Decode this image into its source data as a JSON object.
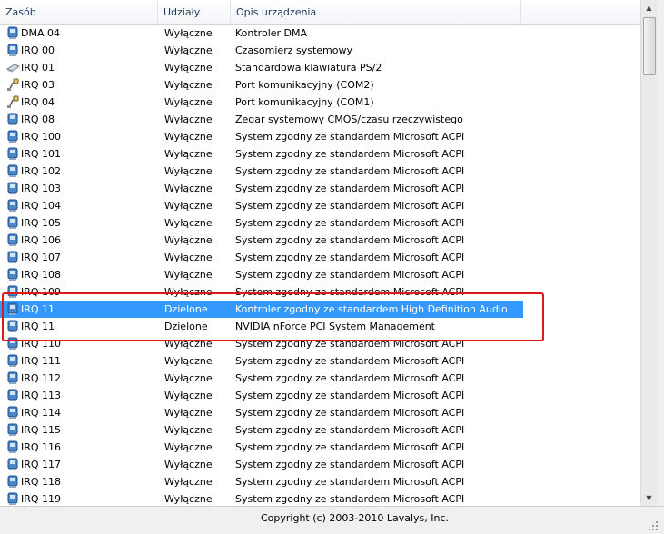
{
  "columns": {
    "resource": "Zasób",
    "shares": "Udziały",
    "description": "Opis urządzenia"
  },
  "rows": [
    {
      "icon": "device-icon",
      "resource": "DMA 04",
      "share": "Wyłączne",
      "description": "Kontroler DMA"
    },
    {
      "icon": "device-icon",
      "resource": "IRQ 00",
      "share": "Wyłączne",
      "description": "Czasomierz systemowy"
    },
    {
      "icon": "keyboard-icon",
      "resource": "IRQ 01",
      "share": "Wyłączne",
      "description": "Standardowa klawiatura PS/2"
    },
    {
      "icon": "port-icon",
      "resource": "IRQ 03",
      "share": "Wyłączne",
      "description": "Port komunikacyjny (COM2)"
    },
    {
      "icon": "port-icon",
      "resource": "IRQ 04",
      "share": "Wyłączne",
      "description": "Port komunikacyjny (COM1)"
    },
    {
      "icon": "device-icon",
      "resource": "IRQ 08",
      "share": "Wyłączne",
      "description": "Zegar systemowy CMOS/czasu rzeczywistego"
    },
    {
      "icon": "device-icon",
      "resource": "IRQ 100",
      "share": "Wyłączne",
      "description": "System zgodny ze standardem Microsoft ACPI"
    },
    {
      "icon": "device-icon",
      "resource": "IRQ 101",
      "share": "Wyłączne",
      "description": "System zgodny ze standardem Microsoft ACPI"
    },
    {
      "icon": "device-icon",
      "resource": "IRQ 102",
      "share": "Wyłączne",
      "description": "System zgodny ze standardem Microsoft ACPI"
    },
    {
      "icon": "device-icon",
      "resource": "IRQ 103",
      "share": "Wyłączne",
      "description": "System zgodny ze standardem Microsoft ACPI"
    },
    {
      "icon": "device-icon",
      "resource": "IRQ 104",
      "share": "Wyłączne",
      "description": "System zgodny ze standardem Microsoft ACPI"
    },
    {
      "icon": "device-icon",
      "resource": "IRQ 105",
      "share": "Wyłączne",
      "description": "System zgodny ze standardem Microsoft ACPI"
    },
    {
      "icon": "device-icon",
      "resource": "IRQ 106",
      "share": "Wyłączne",
      "description": "System zgodny ze standardem Microsoft ACPI"
    },
    {
      "icon": "device-icon",
      "resource": "IRQ 107",
      "share": "Wyłączne",
      "description": "System zgodny ze standardem Microsoft ACPI"
    },
    {
      "icon": "device-icon",
      "resource": "IRQ 108",
      "share": "Wyłączne",
      "description": "System zgodny ze standardem Microsoft ACPI"
    },
    {
      "icon": "device-icon",
      "resource": "IRQ 109",
      "share": "Wyłączne",
      "description": "System zgodny ze standardem Microsoft ACPI"
    },
    {
      "icon": "device-icon",
      "resource": "IRQ 11",
      "share": "Dzielone",
      "description": "Kontroler zgodny ze standardem High Definition Audio",
      "selected": true
    },
    {
      "icon": "device-icon",
      "resource": "IRQ 11",
      "share": "Dzielone",
      "description": "NVIDIA nForce PCI System Management"
    },
    {
      "icon": "device-icon",
      "resource": "IRQ 110",
      "share": "Wyłączne",
      "description": "System zgodny ze standardem Microsoft ACPI"
    },
    {
      "icon": "device-icon",
      "resource": "IRQ 111",
      "share": "Wyłączne",
      "description": "System zgodny ze standardem Microsoft ACPI"
    },
    {
      "icon": "device-icon",
      "resource": "IRQ 112",
      "share": "Wyłączne",
      "description": "System zgodny ze standardem Microsoft ACPI"
    },
    {
      "icon": "device-icon",
      "resource": "IRQ 113",
      "share": "Wyłączne",
      "description": "System zgodny ze standardem Microsoft ACPI"
    },
    {
      "icon": "device-icon",
      "resource": "IRQ 114",
      "share": "Wyłączne",
      "description": "System zgodny ze standardem Microsoft ACPI"
    },
    {
      "icon": "device-icon",
      "resource": "IRQ 115",
      "share": "Wyłączne",
      "description": "System zgodny ze standardem Microsoft ACPI"
    },
    {
      "icon": "device-icon",
      "resource": "IRQ 116",
      "share": "Wyłączne",
      "description": "System zgodny ze standardem Microsoft ACPI"
    },
    {
      "icon": "device-icon",
      "resource": "IRQ 117",
      "share": "Wyłączne",
      "description": "System zgodny ze standardem Microsoft ACPI"
    },
    {
      "icon": "device-icon",
      "resource": "IRQ 118",
      "share": "Wyłączne",
      "description": "System zgodny ze standardem Microsoft ACPI"
    },
    {
      "icon": "device-icon",
      "resource": "IRQ 119",
      "share": "Wyłączne",
      "description": "System zgodny ze standardem Microsoft ACPI"
    }
  ],
  "status": {
    "copyright": "Copyright (c) 2003-2010 Lavalys, Inc."
  },
  "colors": {
    "selection": "#3399ff",
    "highlight_border": "#e01818"
  }
}
